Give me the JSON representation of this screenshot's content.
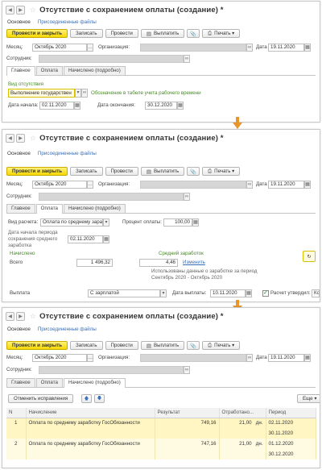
{
  "colors": {
    "primary_button": "#f5d800",
    "link": "#3b6fb6",
    "arrow": "#e8962c",
    "selected_row": "#fff6c4",
    "green_label": "#4a8a2a"
  },
  "icons": {
    "back": "arrow-left-icon",
    "forward": "arrow-right-icon",
    "favorite": "star-icon",
    "pay": "document-pay-icon",
    "attach": "paperclip-icon",
    "print": "printer-icon",
    "select": "ellipsis-icon",
    "open": "link-icon",
    "flow_arrow": "arrow-down-icon"
  },
  "panel1": {
    "title": "Отсутствие с сохранением оплаты (создание) *",
    "nav_main": "Основное",
    "nav_files": "Присоединенные файлы",
    "toolbar": {
      "post_close": "Провести и закрыть",
      "write": "Записать",
      "post": "Провести",
      "pay": "Выплатить",
      "print": "Печать"
    },
    "month_label": "Месяц:",
    "month_value": "Октябрь 2020",
    "org_label": "Организация:",
    "date_label": "Дата",
    "date_value": "19.11.2020",
    "employee_label": "Сотрудник:",
    "tabs": [
      "Главное",
      "Оплата",
      "Начислено (подробно)"
    ],
    "absence_type_label": "Вид отсутствия",
    "absence_type_value": "Выполнение государствен",
    "designation_label": "Обозначение в табеле учета рабочего времени",
    "start_label": "Дата начала:",
    "start_value": "02.11.2020",
    "end_label": "Дата окончания:",
    "end_value": "30.12.2020"
  },
  "panel2": {
    "title": "Отсутствие с сохранением оплаты (создание) *",
    "nav_main": "Основное",
    "nav_files": "Присоединенные файлы",
    "toolbar": {
      "post_close": "Провести и закрыть",
      "write": "Записать",
      "post": "Провести",
      "pay": "Выплатить",
      "print": "Печать"
    },
    "month_label": "Месяц:",
    "month_value": "Октябрь 2020",
    "org_label": "Организация:",
    "date_label": "Дата",
    "date_value": "19.11.2020",
    "employee_label": "Сотрудник:",
    "tabs": [
      "Главное",
      "Оплата",
      "Начислено (подробно)"
    ],
    "calc_type_label": "Вид расчета:",
    "calc_type_value": "Оплата по среднему зара",
    "pay_percent_label": "Процент оплаты:",
    "pay_percent_value": "100,00",
    "period_label": "Дата начала периода сохранения среднего заработка",
    "period_value": "02.11.2020",
    "accrued_label": "Начислено",
    "total_label": "Всего",
    "total_value": "1 496,32",
    "avg_label": "Средний заработок",
    "avg_value": "4,46",
    "change_link": "Изменить",
    "used_note": "Использованы данные о заработке за период Сентябрь 2020 - Октябрь 2020",
    "payout_label": "Выплата",
    "payout_value": "С зарплатой",
    "payout_date_label": "Дата выплаты:",
    "payout_date_value": "10.11.2020",
    "approved_label": "Расчет утвердил:",
    "approved_value": "Ко"
  },
  "panel3": {
    "title": "Отсутствие с сохранением оплаты (создание) *",
    "nav_main": "Основное",
    "nav_files": "Присоединенные файлы",
    "toolbar": {
      "post_close": "Провести и закрыть",
      "write": "Записать",
      "post": "Провести",
      "pay": "Выплатить",
      "print": "Печать"
    },
    "month_label": "Месяц:",
    "month_value": "Октябрь 2020",
    "org_label": "Организация:",
    "date_label": "Дата",
    "date_value": "19.11.2020",
    "employee_label": "Сотрудник:",
    "tabs": [
      "Главное",
      "Оплата",
      "Начислено (подробно)"
    ],
    "cancel_fix": "Отменить исправления",
    "more": "Еще",
    "table": {
      "headers": [
        "N",
        "Начисление",
        "Результат",
        "Отработано...",
        "Период"
      ],
      "rows": [
        {
          "n": "1",
          "accrual": "Оплата по среднему заработку ГосОбязанности",
          "result": "749,16",
          "worked": "21,00",
          "unit": "дн.",
          "period_from": "02.11.2020",
          "period_to": "30.11.2020"
        },
        {
          "n": "2",
          "accrual": "Оплата по среднему заработку ГосОбязанности",
          "result": "747,16",
          "worked": "21,00",
          "unit": "дн.",
          "period_from": "01.12.2020",
          "period_to": "30.12.2020"
        }
      ]
    }
  }
}
